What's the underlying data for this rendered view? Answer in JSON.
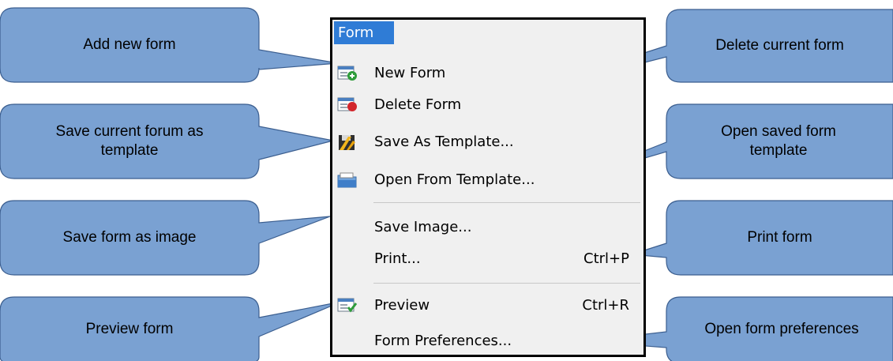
{
  "menu": {
    "title": "Form",
    "items": [
      {
        "label": "New Form",
        "shortcut": "",
        "icon": "new-form-icon"
      },
      {
        "label": "Delete Form",
        "shortcut": "",
        "icon": "delete-form-icon"
      },
      {
        "label": "Save As Template...",
        "shortcut": "",
        "icon": "save-template-icon"
      },
      {
        "label": "Open From Template...",
        "shortcut": "",
        "icon": "open-template-icon"
      },
      {
        "label": "Save Image...",
        "shortcut": ""
      },
      {
        "label": "Print...",
        "shortcut": "Ctrl+P"
      },
      {
        "label": "Preview",
        "shortcut": "Ctrl+R",
        "icon": "preview-icon"
      },
      {
        "label": "Form Preferences...",
        "shortcut": ""
      }
    ]
  },
  "callouts": {
    "add_new": "Add new form",
    "save_template": "Save current forum as template",
    "save_image": "Save form as image",
    "preview": "Preview form",
    "delete_current": "Delete current form",
    "open_template": "Open saved form template",
    "print": "Print form",
    "preferences": "Open form preferences"
  },
  "colors": {
    "callout_fill": "#7aa1d2",
    "callout_stroke": "#3b5e8f",
    "menu_title_bg": "#2f7cd6",
    "menu_bg": "#f0f0f0"
  }
}
